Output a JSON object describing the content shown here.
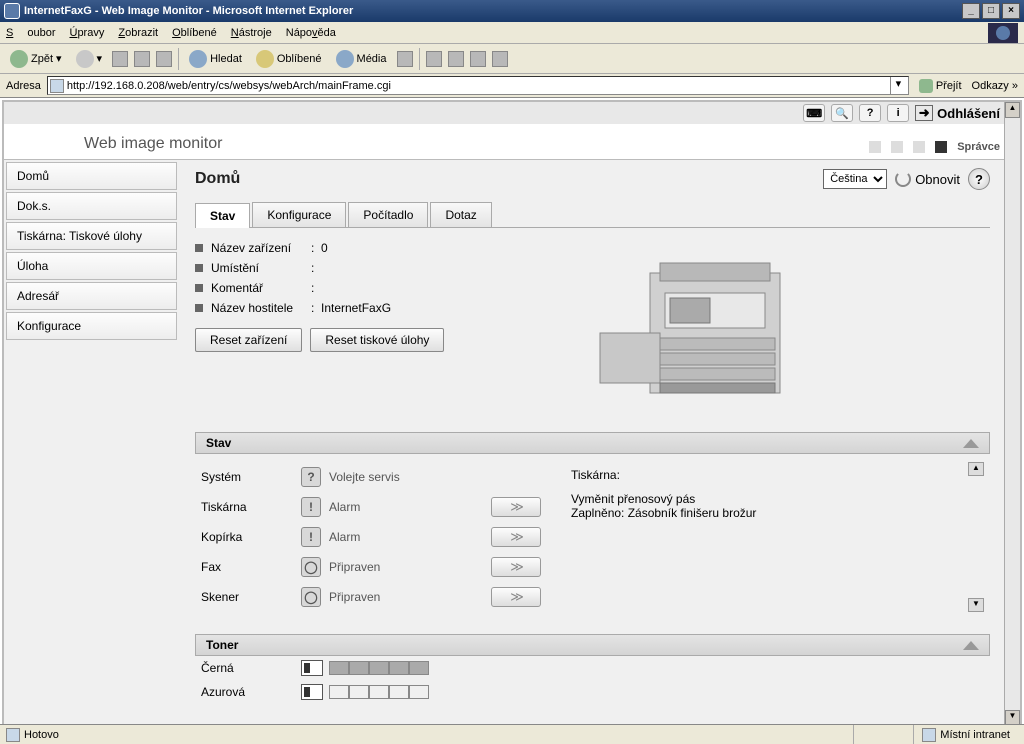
{
  "window": {
    "title": "InternetFaxG - Web Image Monitor - Microsoft Internet Explorer"
  },
  "menubar": {
    "items": [
      "Soubor",
      "Úpravy",
      "Zobrazit",
      "Oblíbené",
      "Nástroje",
      "Nápověda"
    ]
  },
  "toolbar": {
    "back": "Zpět",
    "search": "Hledat",
    "favorites": "Oblíbené",
    "media": "Média"
  },
  "addressbar": {
    "label": "Adresa",
    "url": "http://192.168.0.208/web/entry/cs/websys/webArch/mainFrame.cgi",
    "go": "Přejít",
    "links": "Odkazy"
  },
  "top": {
    "logout": "Odhlášení"
  },
  "header": {
    "product": "Web image monitor",
    "role": "Správce"
  },
  "sidebar": {
    "items": [
      "Domů",
      "Dok.s.",
      "Tiskárna: Tiskové úlohy",
      "Úloha",
      "Adresář",
      "Konfigurace"
    ]
  },
  "main": {
    "title": "Domů",
    "lang": "Čeština",
    "refresh": "Obnovit",
    "tabs": [
      "Stav",
      "Konfigurace",
      "Počítadlo",
      "Dotaz"
    ],
    "info": {
      "device_name_label": "Název zařízení",
      "device_name_value": "0",
      "location_label": "Umístění",
      "location_value": "",
      "comment_label": "Komentář",
      "comment_value": "",
      "host_label": "Název hostitele",
      "host_value": "InternetFaxG"
    },
    "reset_device": "Reset zařízení",
    "reset_jobs": "Reset tiskové úlohy"
  },
  "status_section": {
    "heading": "Stav",
    "rows": [
      {
        "label": "Systém",
        "icon": "?",
        "text": "Volejte servis",
        "arrow": false
      },
      {
        "label": "Tiskárna",
        "icon": "!",
        "text": "Alarm",
        "arrow": true
      },
      {
        "label": "Kopírka",
        "icon": "!",
        "text": "Alarm",
        "arrow": true
      },
      {
        "label": "Fax",
        "icon": "◯",
        "text": "Připraven",
        "arrow": true
      },
      {
        "label": "Skener",
        "icon": "◯",
        "text": "Připraven",
        "arrow": true
      }
    ],
    "msg_title": "Tiskárna:",
    "msg_line1": "Vyměnit přenosový pás",
    "msg_line2": "Zaplněno: Zásobník finišeru brožur"
  },
  "toner_section": {
    "heading": "Toner",
    "rows": [
      {
        "label": "Černá",
        "level": 5
      },
      {
        "label": "Azurová",
        "level": 0
      }
    ]
  },
  "statusbar": {
    "done": "Hotovo",
    "zone": "Místní intranet"
  }
}
